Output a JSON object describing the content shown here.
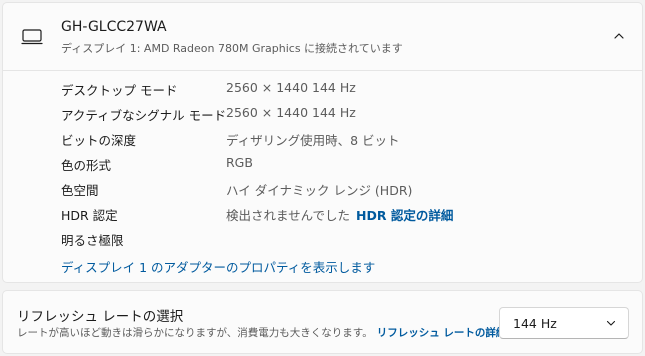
{
  "display": {
    "monitor_name": "GH-GLCC27WA",
    "subtitle": "ディスプレイ 1: AMD Radeon 780M Graphics に接続されています",
    "header_icon": "monitor-icon",
    "collapse_icon": "chevron-up-icon",
    "properties": [
      {
        "label": "デスクトップ モード",
        "value": "2560 × 1440 144 Hz"
      },
      {
        "label": "アクティブなシグナル モード",
        "value": "2560 × 1440 144 Hz"
      },
      {
        "label": "ビットの深度",
        "value": "ディザリング使用時、8 ビット"
      },
      {
        "label": "色の形式",
        "value": "RGB"
      },
      {
        "label": "色空間",
        "value": "ハイ ダイナミック レンジ (HDR)"
      },
      {
        "label": "HDR 認定",
        "value": "検出されませんでした",
        "link": "HDR 認定の詳細"
      },
      {
        "label": "明るさ極限",
        "value": ""
      }
    ],
    "adapter_link": "ディスプレイ 1 のアダプターのプロパティを表示します"
  },
  "refresh": {
    "title": "リフレッシュ レートの選択",
    "description": "レートが高いほど動きは滑らかになりますが、消費電力も大きくなります。",
    "link": "リフレッシュ レートの詳細",
    "selected": "144 Hz",
    "dropdown_icon": "chevron-down-icon"
  },
  "colors": {
    "accent": "#005a9e",
    "card_background": "#fbfbfb",
    "page_background": "#f3f3f3"
  }
}
